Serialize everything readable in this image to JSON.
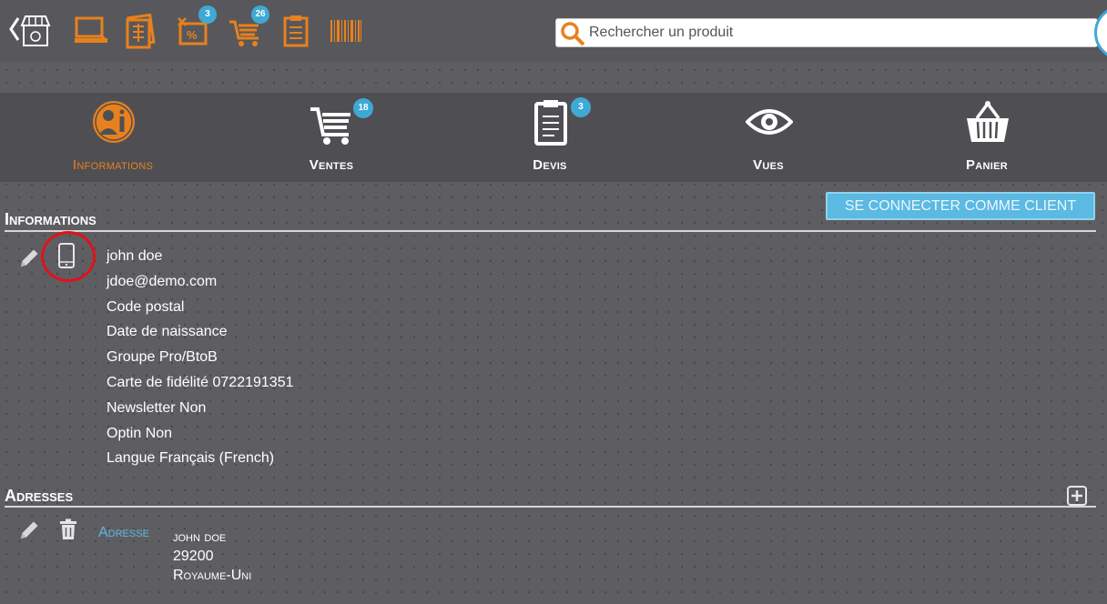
{
  "toolbar": {
    "badges": {
      "promos": "3",
      "cart": "26"
    },
    "search_placeholder": "Rechercher un produit"
  },
  "tabs": [
    {
      "label": "Informations",
      "active": true
    },
    {
      "label": "Ventes",
      "badge": "18"
    },
    {
      "label": "Devis",
      "badge": "3"
    },
    {
      "label": "Vues"
    },
    {
      "label": "Panier"
    }
  ],
  "connect_button": "SE CONNECTER COMME CLIENT",
  "informations": {
    "title": "Informations",
    "lines": [
      "john doe",
      "jdoe@demo.com",
      "Code postal",
      "Date de naissance",
      "Groupe Pro/BtoB",
      "Carte de fidélité 0722191351",
      "Newsletter Non",
      "Optin Non",
      "Langue Français (French)"
    ]
  },
  "adresses": {
    "title": "Adresses",
    "address_label": "Adresse",
    "address_lines": [
      "john doe",
      "29200",
      "Royaume-Uni"
    ]
  },
  "colors": {
    "accent": "#e8811d",
    "badge": "#3fa9d6",
    "button": "#5bb9e2",
    "highlight_ring": "#e0121b"
  }
}
